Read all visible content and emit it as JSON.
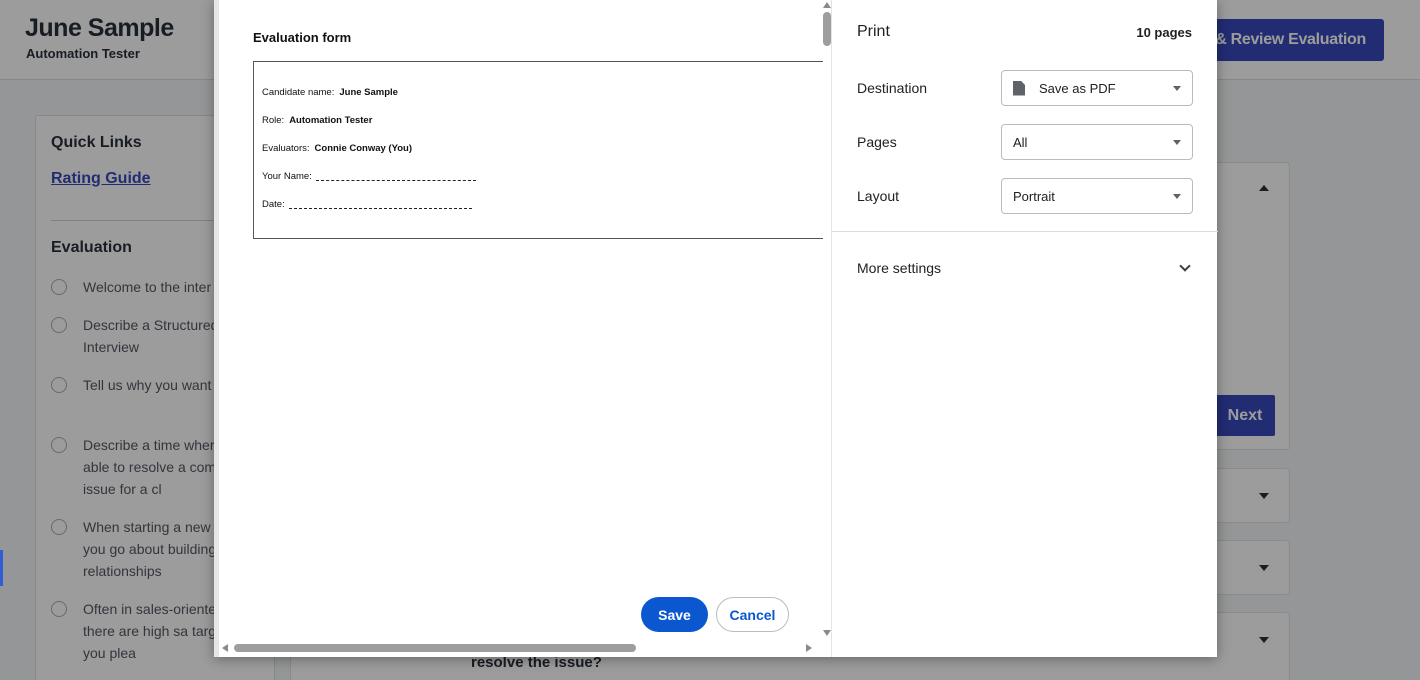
{
  "app": {
    "candidate_name": "June Sample",
    "candidate_role": "Automation Tester",
    "submit_button": "t & Review Evaluation",
    "quick_links_title": "Quick Links",
    "rating_guide_link": "Rating Guide",
    "evaluation_title": "Evaluation",
    "questions": [
      "Welcome to the inter",
      "Describe a Structured Interview",
      "Tell us why you want t job.",
      "Describe a time wher were able to resolve a complex issue for a cl",
      "When starting a new how do you go about building relationships",
      "Often in sales-oriente roles there are high sa targets. Can you plea"
    ],
    "next_button": "Next",
    "card_question_fragment": "resolve the issue?"
  },
  "print_dialog": {
    "title": "Print",
    "page_count": "10 pages",
    "destination_label": "Destination",
    "destination_value": "Save as PDF",
    "destination_icon": "document-icon",
    "pages_label": "Pages",
    "pages_value": "All",
    "layout_label": "Layout",
    "layout_value": "Portrait",
    "more_settings": "More settings",
    "save_button": "Save",
    "cancel_button": "Cancel",
    "accent_color": "#0b57d0"
  },
  "preview": {
    "form_title": "Evaluation form",
    "candidate_label": "Candidate name:",
    "candidate_value": "June Sample",
    "role_label": "Role:",
    "role_value": "Automation Tester",
    "evaluators_label": "Evaluators:",
    "evaluators_value": "Connie Conway (You)",
    "your_name_label": "Your Name:",
    "date_label": "Date:"
  }
}
